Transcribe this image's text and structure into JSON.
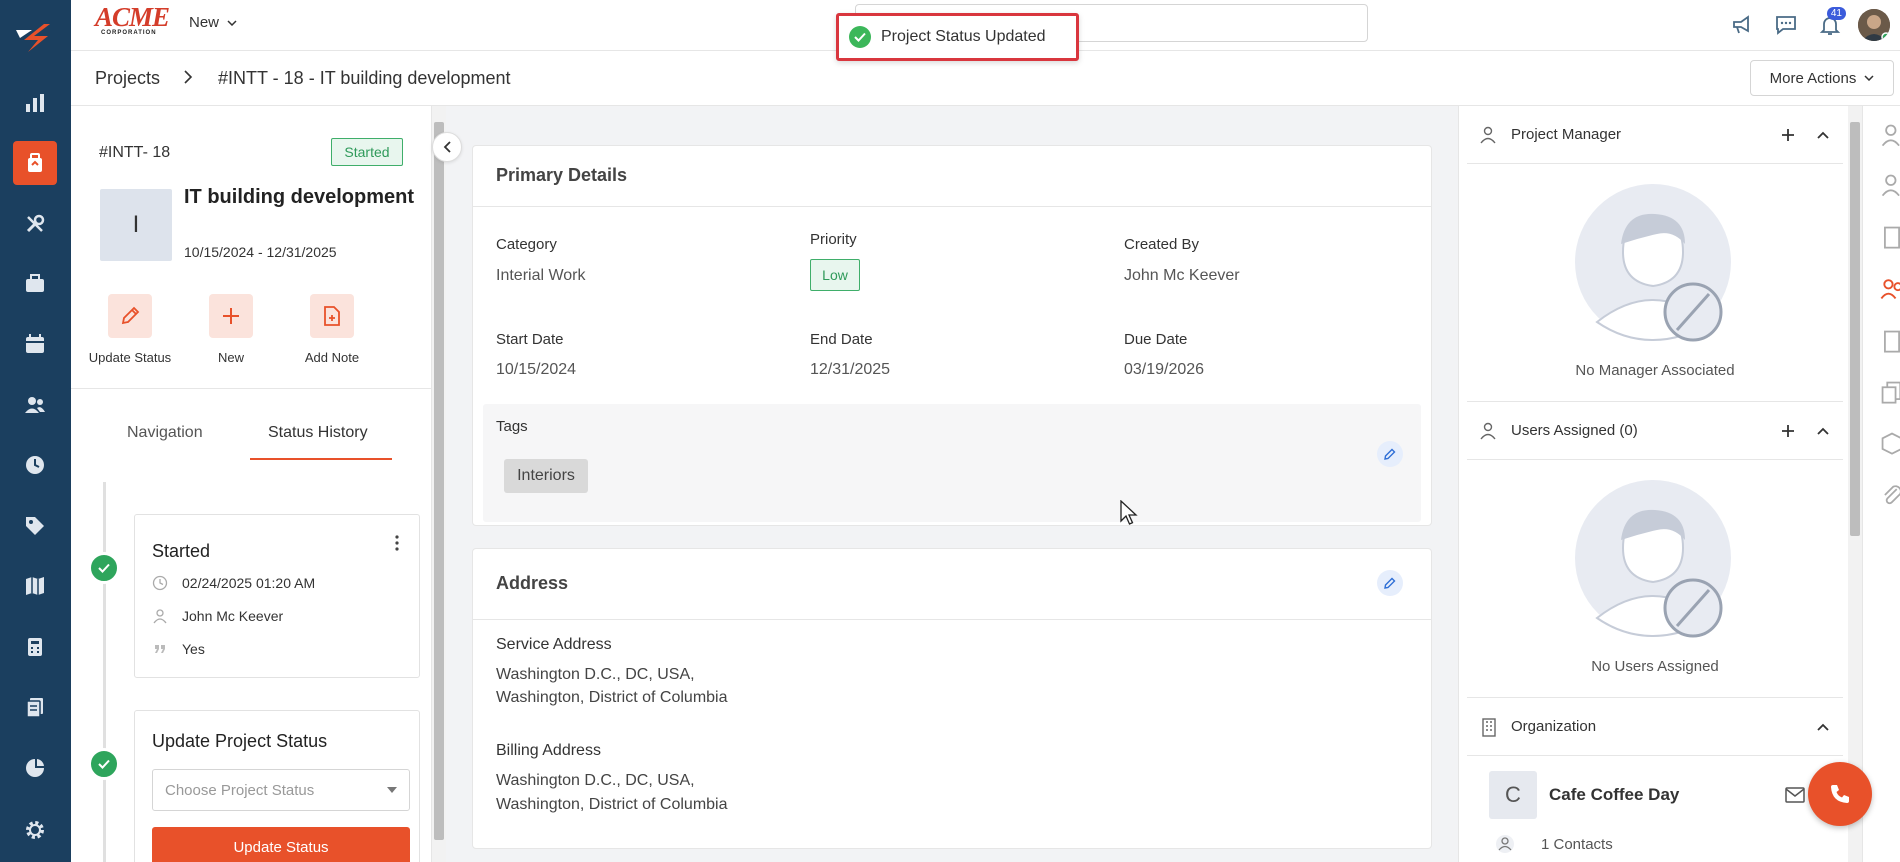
{
  "topbar": {
    "brand_name": "ACME",
    "brand_sub": "CORPORATION",
    "new_label": "New",
    "notification_count": "41"
  },
  "toast": {
    "message": "Project Status Updated"
  },
  "breadcrumb": {
    "root": "Projects",
    "current": "#INTT - 18 - IT building development",
    "more_actions": "More Actions"
  },
  "project": {
    "id": "#INTT- 18",
    "status_badge": "Started",
    "avatar_letter": "I",
    "title": "IT building development",
    "dates": "10/15/2024 - 12/31/2025"
  },
  "quick_actions": [
    {
      "label": "Update Status"
    },
    {
      "label": "New"
    },
    {
      "label": "Add Note"
    }
  ],
  "left_tabs": {
    "navigation": "Navigation",
    "status_history": "Status History"
  },
  "status_history": {
    "entry_title": "Started",
    "datetime": "02/24/2025 01:20 AM",
    "user": "John Mc Keever",
    "comment": "Yes"
  },
  "update_status": {
    "title": "Update Project Status",
    "placeholder": "Choose Project Status",
    "button": "Update Status"
  },
  "primary_details": {
    "title": "Primary Details",
    "category_label": "Category",
    "category_value": "Interial Work",
    "priority_label": "Priority",
    "priority_value": "Low",
    "created_by_label": "Created By",
    "created_by_value": "John Mc Keever",
    "start_date_label": "Start Date",
    "start_date_value": "10/15/2024",
    "end_date_label": "End Date",
    "end_date_value": "12/31/2025",
    "due_date_label": "Due Date",
    "due_date_value": "03/19/2026",
    "tags_label": "Tags",
    "tags": [
      "Interiors"
    ]
  },
  "address": {
    "title": "Address",
    "service_label": "Service Address",
    "service_line1": "Washington D.C., DC, USA,",
    "service_line2": "Washington, District of Columbia",
    "billing_label": "Billing Address",
    "billing_line1": "Washington D.C., DC, USA,",
    "billing_line2": "Washington, District of Columbia"
  },
  "right_panel": {
    "manager_title": "Project Manager",
    "no_manager": "No Manager Associated",
    "users_title": "Users Assigned (0)",
    "no_users": "No Users Assigned",
    "org_title": "Organization",
    "org_letter": "C",
    "org_name": "Cafe Coffee Day",
    "org_contacts": "1 Contacts"
  },
  "colors": {
    "rail": "#1b3f5f",
    "accent": "#e8512a",
    "success": "#2ea55c"
  }
}
